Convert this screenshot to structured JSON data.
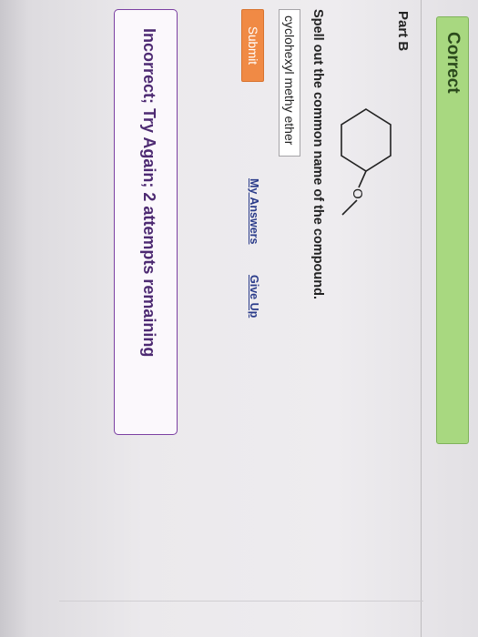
{
  "status_banner": {
    "label": "Correct",
    "color": "#a8d880"
  },
  "part": {
    "title": "Part B"
  },
  "molecule": {
    "atom_label": "O",
    "icon": "cyclohexyl-methyl-ether-structure"
  },
  "question": {
    "text": "Spell out the common name of the compound."
  },
  "answer": {
    "value": "cyclohexyl methy ether"
  },
  "actions": {
    "submit_label": "Submit",
    "submit_color": "#f08a45",
    "my_answers_label": "My Answers",
    "give_up_label": "Give Up"
  },
  "feedback": {
    "text": "Incorrect; Try Again; 2 attempts remaining",
    "color": "#4d2a72"
  }
}
